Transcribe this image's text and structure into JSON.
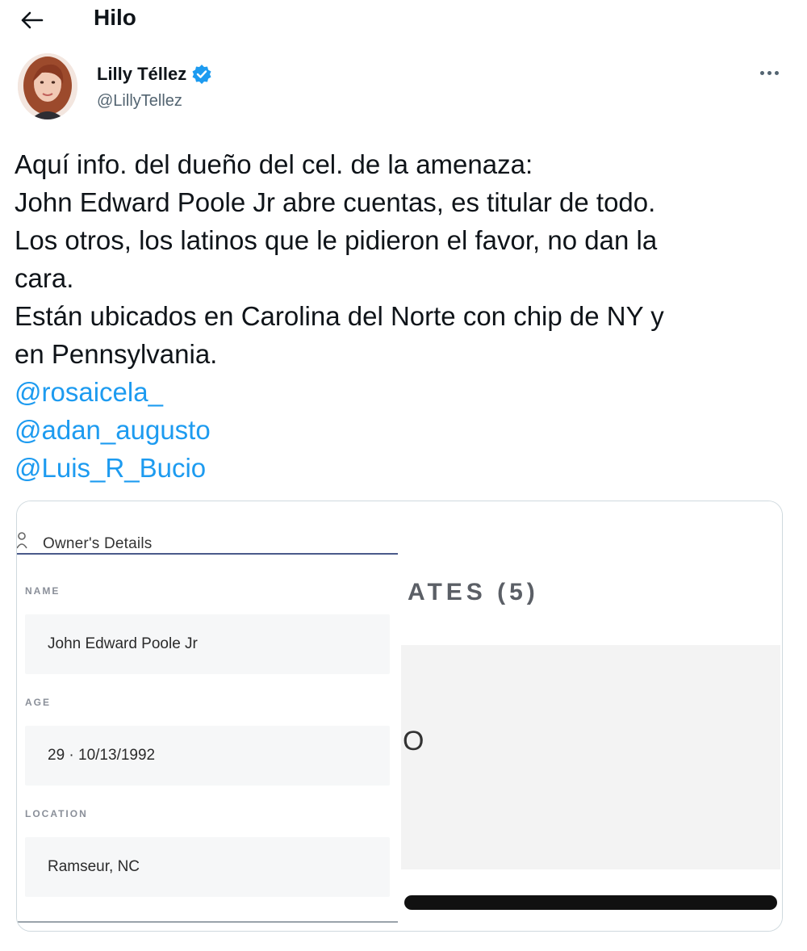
{
  "header": {
    "title": "Hilo"
  },
  "author": {
    "name": "Lilly Téllez",
    "handle": "@LillyTellez",
    "verified": true
  },
  "tweet": {
    "lines": [
      "Aquí info. del dueño del cel. de la amenaza:",
      "John Edward Poole Jr abre cuentas, es titular de todo.",
      "Los otros, los latinos que le pidieron el favor, no dan la",
      "cara.",
      "Están ubicados en Carolina del Norte con chip de NY y",
      "en Pennsylvania."
    ],
    "mentions": [
      "@rosaicela_",
      "@adan_augusto",
      "@Luis_R_Bucio"
    ]
  },
  "media": {
    "panel_title": "Owner's Details",
    "fields": [
      {
        "label": "NAME",
        "value": "John Edward Poole Jr"
      },
      {
        "label": "AGE",
        "value": "29 · 10/13/1992"
      },
      {
        "label": "LOCATION",
        "value": "Ramseur, NC"
      }
    ],
    "right_title": "ATES (5)",
    "right_letter": "O"
  },
  "colors": {
    "text": "#0f1419",
    "secondary": "#536471",
    "link": "#1d9bf0",
    "verified": "#1d9bf0",
    "border": "#cfd9de"
  },
  "icons": [
    "back-arrow-icon",
    "verified-badge-icon",
    "more-icon",
    "person-icon"
  ]
}
